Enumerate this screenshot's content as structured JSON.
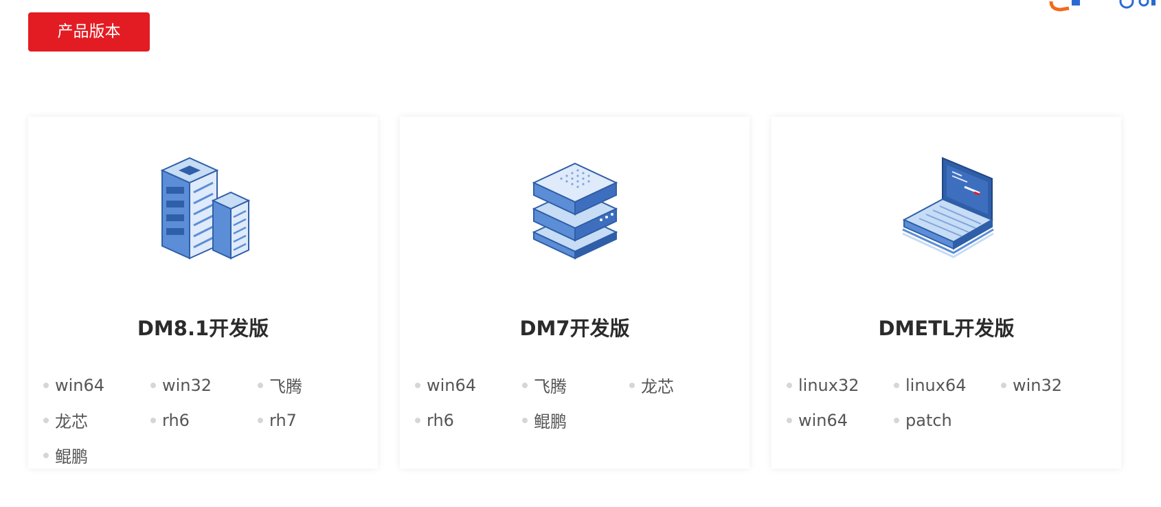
{
  "section": {
    "button_label": "产品版本"
  },
  "colors": {
    "accent": "#e31c23",
    "icon_dark": "#2f5fa8",
    "icon_mid": "#5b8ed6",
    "icon_light": "#c7dcf5"
  },
  "cards": [
    {
      "title": "DM8.1开发版",
      "icon": "server-building-icon",
      "links": [
        "win64",
        "win32",
        "飞腾",
        "龙芯",
        "rh6",
        "rh7",
        "鲲鹏"
      ]
    },
    {
      "title": "DM7开发版",
      "icon": "server-stack-icon",
      "links": [
        "win64",
        "飞腾",
        "龙芯",
        "rh6",
        "鲲鹏"
      ]
    },
    {
      "title": "DMETL开发版",
      "icon": "laptop-icon",
      "links": [
        "linux32",
        "linux64",
        "win32",
        "win64",
        "patch"
      ]
    }
  ]
}
